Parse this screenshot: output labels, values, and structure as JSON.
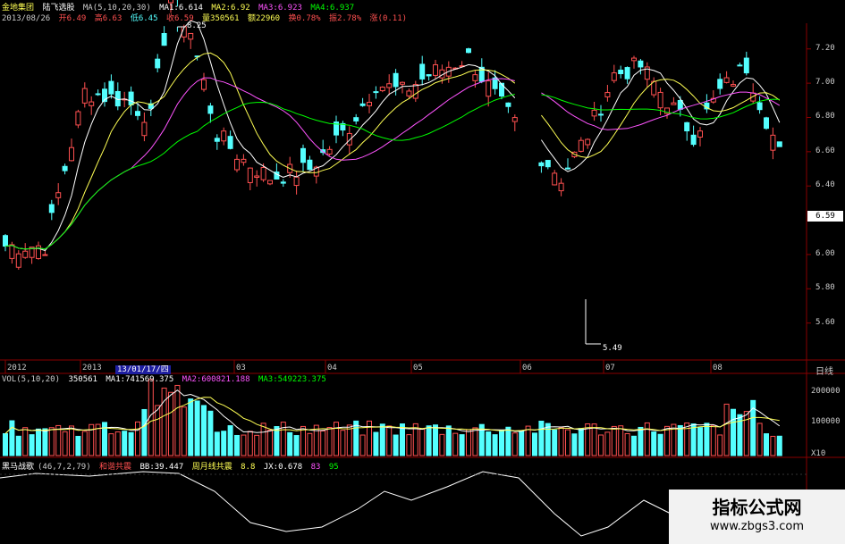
{
  "header": {
    "stock_name": "金地集团",
    "indicator_name": "陆飞选股",
    "date": "2013/08/26",
    "open": "开6.49",
    "high": "高6.63",
    "low": "低6.45",
    "close": "收6.59",
    "volume": "量350561",
    "amount": "额22960",
    "turnover": "换0.78%",
    "amplitude": "振2.78%",
    "change": "涨(0.11)"
  },
  "ma": {
    "params": "MA(5,10,20,30)",
    "ma1": "MA1:6.614",
    "ma2": "MA2:6.92",
    "ma3": "MA3:6.923",
    "ma4": "MA4:6.937"
  },
  "vol": {
    "params": "VOL(5,10,20)",
    "value": "350561",
    "ma1": "MA1:741569.375",
    "ma2": "MA2:600821.188",
    "ma3": "MA3:549223.375"
  },
  "osc": {
    "name": "黑马战歌",
    "params": "(46,7,2,79)",
    "sig1": "和谐共震",
    "bb": "BB:39.447",
    "sig2": "周月线共震",
    "v1": "8.8",
    "jx": "JX:0.678",
    "v2": "83",
    "v3": "95"
  },
  "price_axis": [
    "7.20",
    "7.00",
    "6.80",
    "6.60",
    "6.40",
    "6.20",
    "6.00",
    "5.80",
    "5.60"
  ],
  "current_price": "6.59",
  "high_label": "8.25",
  "low_label": "5.49",
  "time_axis": [
    "2012",
    "2013",
    "03",
    "04",
    "05",
    "06",
    "07",
    "08"
  ],
  "date_highlight": "13/01/17/四",
  "period": "日线",
  "vol_axis": [
    "200000",
    "100000",
    "X10"
  ],
  "watermark": {
    "title": "指标公式网",
    "url": "www.zbgs3.com"
  },
  "colors": {
    "up": "#ff5050",
    "down": "#54ffff",
    "ma1": "#ffffff",
    "ma2": "#ffff54",
    "ma3": "#ff54ff",
    "ma4": "#00ff00"
  },
  "chart_data": {
    "type": "candlestick",
    "price_range": [
      5.4,
      7.35
    ],
    "high": 8.25,
    "low": 5.49,
    "last_close": 6.59
  }
}
